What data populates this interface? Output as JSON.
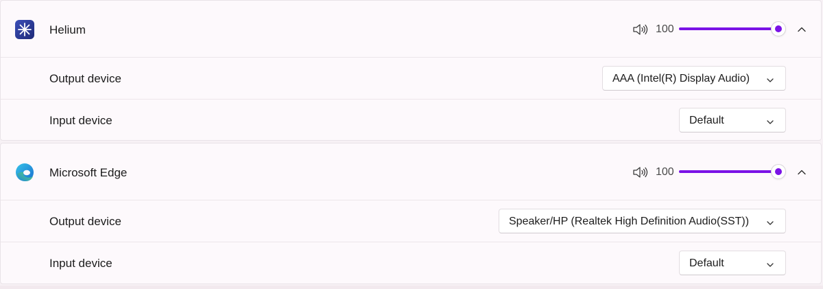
{
  "apps": [
    {
      "name": "Helium",
      "icon": "helium-app-icon",
      "volume": "100",
      "volume_fraction": 1.0,
      "output_label": "Output device",
      "output_value": "AAA (Intel(R) Display Audio)",
      "input_label": "Input device",
      "input_value": "Default"
    },
    {
      "name": "Microsoft Edge",
      "icon": "edge-app-icon",
      "volume": "100",
      "volume_fraction": 1.0,
      "output_label": "Output device",
      "output_value": "Speaker/HP (Realtek High Definition Audio(SST))",
      "input_label": "Input device",
      "input_value": "Default"
    }
  ],
  "colors": {
    "accent": "#7a12e6",
    "page_bg": "#f7f1f5",
    "card_bg": "#fdf9fc"
  }
}
